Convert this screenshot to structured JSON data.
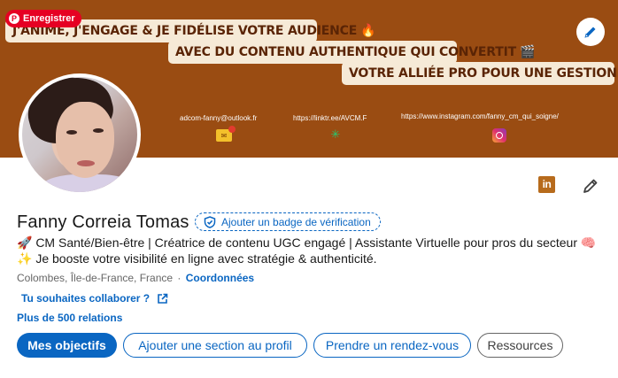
{
  "banner": {
    "line1": "J'ANIME, J'ENGAGE & JE FIDÉLISE VOTRE AUDIENCE",
    "line1_emoji": "🔥",
    "line2": "AVEC DU CONTENU AUTHENTIQUE QUI CONVERTIT",
    "line2_emoji": "🎬",
    "line3": "VOTRE ALLIÉE PRO POUR UNE GESTION FLUIDE",
    "line3_emoji": "⚡",
    "contacts": [
      {
        "text": "adcom-fanny@outlook.fr",
        "icon": "mail-icon"
      },
      {
        "text": "https://linktr.ee/AVCM.F",
        "icon": "linktree-icon"
      },
      {
        "text": "https://www.instagram.com/fanny_cm_qui_soigne/",
        "icon": "instagram-icon"
      }
    ]
  },
  "save_badge": {
    "label": "Enregistrer",
    "icon": "pinterest-icon"
  },
  "profile": {
    "name": "Fanny Correia Tomas",
    "verify_label": "Ajouter un badge de vérification",
    "headline_line1": "🚀 CM Santé/Bien-être | Créatrice de contenu UGC engagé | Assistante Virtuelle pour pros du secteur 🧠",
    "headline_line2": "✨ Je booste votre visibilité en ligne avec stratégie & authenticité.",
    "location": "Colombes, Île-de-France, France",
    "location_sep": "·",
    "coordinates_link": "Coordonnées",
    "collab_link": "Tu souhaites collaborer ?",
    "relations": "Plus de 500 relations"
  },
  "actions": {
    "goals": "Mes objectifs",
    "add_section": "Ajouter une section au profil",
    "appointment": "Prendre un rendez-vous",
    "resources": "Ressources"
  },
  "company_logo": "in",
  "colors": {
    "brand_blue": "#0a66c2",
    "banner_bg": "#9a4c12",
    "banner_text": "#5a2405",
    "pinterest_red": "#e60023"
  }
}
